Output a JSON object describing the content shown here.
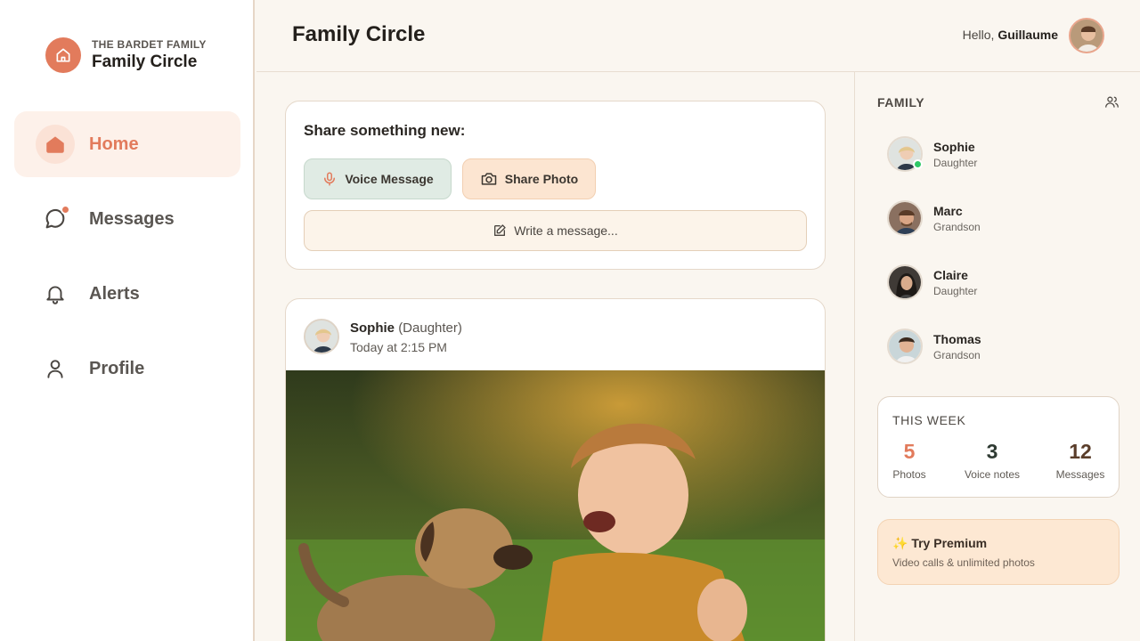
{
  "brand": {
    "family": "THE BARDET FAMILY",
    "name": "Family Circle",
    "icon": "home-icon"
  },
  "nav": {
    "items": [
      {
        "label": "Home",
        "icon": "home-icon",
        "active": true
      },
      {
        "label": "Messages",
        "icon": "chat-bubble-icon",
        "badge": "notification-dot"
      },
      {
        "label": "Alerts",
        "icon": "bell-icon"
      },
      {
        "label": "Profile",
        "icon": "person-icon"
      }
    ]
  },
  "header": {
    "title": "Family Circle",
    "greeting_prefix": "Hello, ",
    "user_name": "Guillaume"
  },
  "composer": {
    "title": "Share something new:",
    "voice_label": "Voice Message",
    "photo_label": "Share Photo",
    "write_label": "Write a message..."
  },
  "post": {
    "author": "Sophie",
    "role": "(Daughter)",
    "time": "Today at 2:15 PM",
    "photo_desc": "toddler-laughing-with-puppy-photo"
  },
  "family": {
    "title": "FAMILY",
    "members": [
      {
        "name": "Sophie",
        "role": "Daughter",
        "online": true
      },
      {
        "name": "Marc",
        "role": "Grandson"
      },
      {
        "name": "Claire",
        "role": "Daughter"
      },
      {
        "name": "Thomas",
        "role": "Grandson"
      }
    ]
  },
  "week": {
    "title": "THIS WEEK",
    "stats": [
      {
        "value": "5",
        "label": "Photos",
        "color": "#e27b5c"
      },
      {
        "value": "3",
        "label": "Voice notes",
        "color": "#2f3b33"
      },
      {
        "value": "12",
        "label": "Messages",
        "color": "#5a3d2a"
      }
    ]
  },
  "premium": {
    "title": "✨ Try Premium",
    "subtitle": "Video calls & unlimited photos"
  },
  "colors": {
    "accent": "#e27b5c",
    "voice_bg": "#e0ebe4",
    "photo_bg": "#fce5d1",
    "online": "#2ec866"
  }
}
